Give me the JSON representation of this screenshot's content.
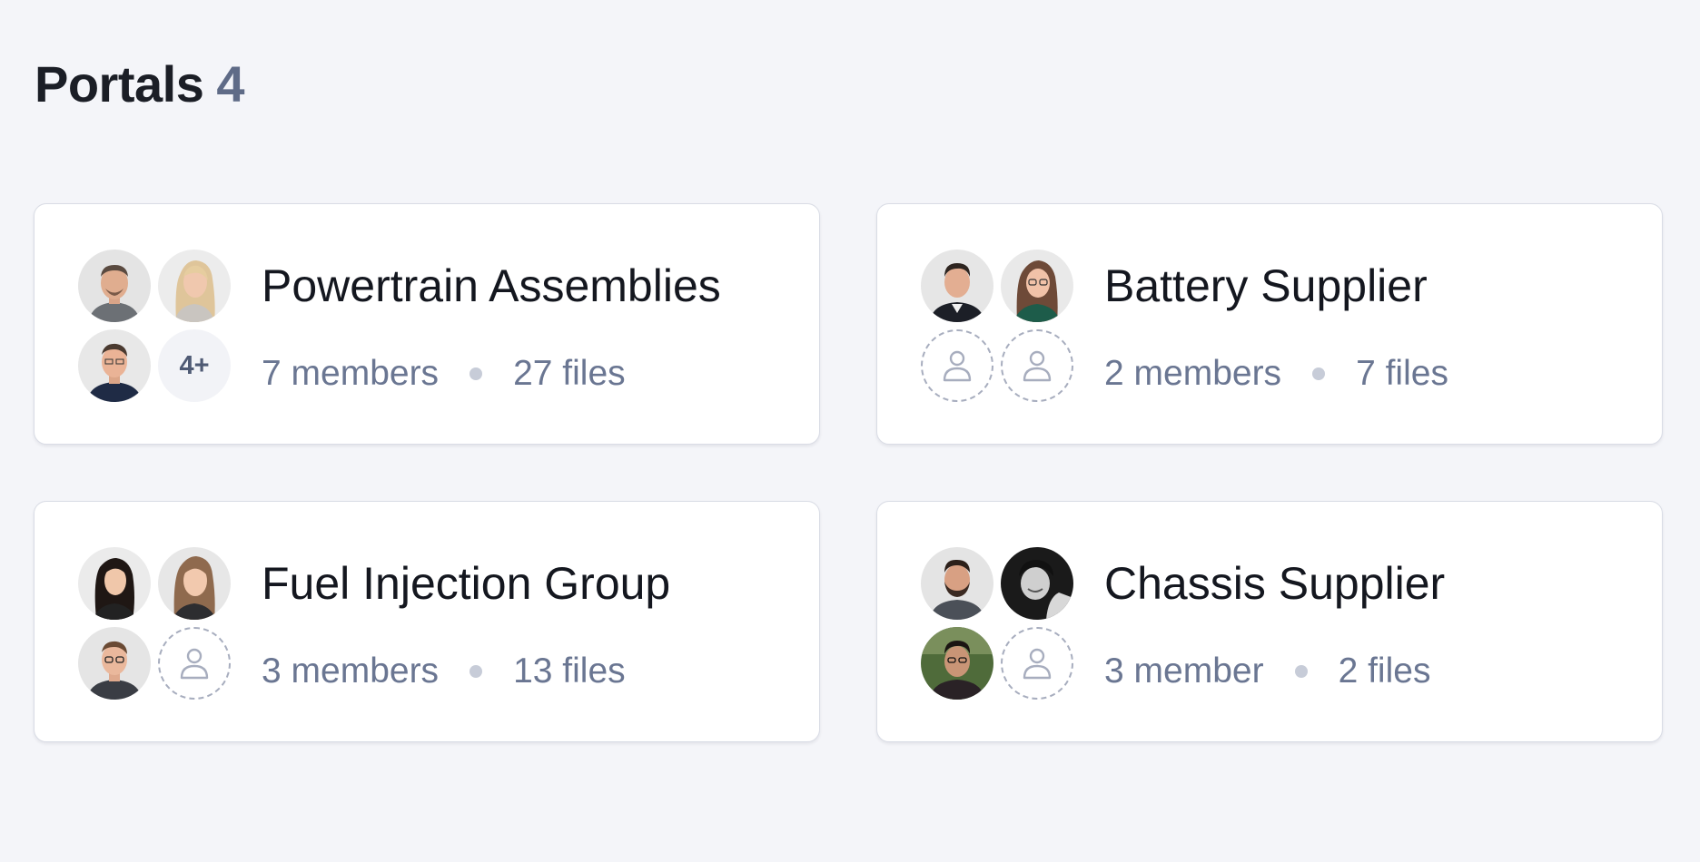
{
  "header": {
    "title": "Portals",
    "count": "4"
  },
  "portals": [
    {
      "name": "Powertrain Assemblies",
      "members": "7 members",
      "files": "27 files",
      "more_label": "4+",
      "avatars": [
        "avatar-man-gray-shirt",
        "avatar-woman-blonde",
        "avatar-man-navy-shirt",
        "more-members"
      ]
    },
    {
      "name": "Battery Supplier",
      "members": "2 members",
      "files": "7 files",
      "avatars": [
        "avatar-man-dark-jacket",
        "avatar-woman-glasses",
        "placeholder-user-icon",
        "placeholder-user-icon"
      ]
    },
    {
      "name": "Fuel Injection Group",
      "members": "3 members",
      "files": "13 files",
      "avatars": [
        "avatar-woman-dark-hair",
        "avatar-woman-light-brown-hair",
        "avatar-man-glasses",
        "placeholder-user-icon"
      ]
    },
    {
      "name": "Chassis Supplier",
      "members": "3 member",
      "files": "2 files",
      "avatars": [
        "avatar-man-beard",
        "avatar-man-bw-photo",
        "avatar-man-outdoor",
        "placeholder-user-icon"
      ]
    }
  ],
  "colors": {
    "background": "#f4f5f9",
    "card": "#ffffff",
    "muted_text": "#6a7692",
    "count_text": "#5f6b87",
    "separator_dot": "#c7ccd8"
  }
}
